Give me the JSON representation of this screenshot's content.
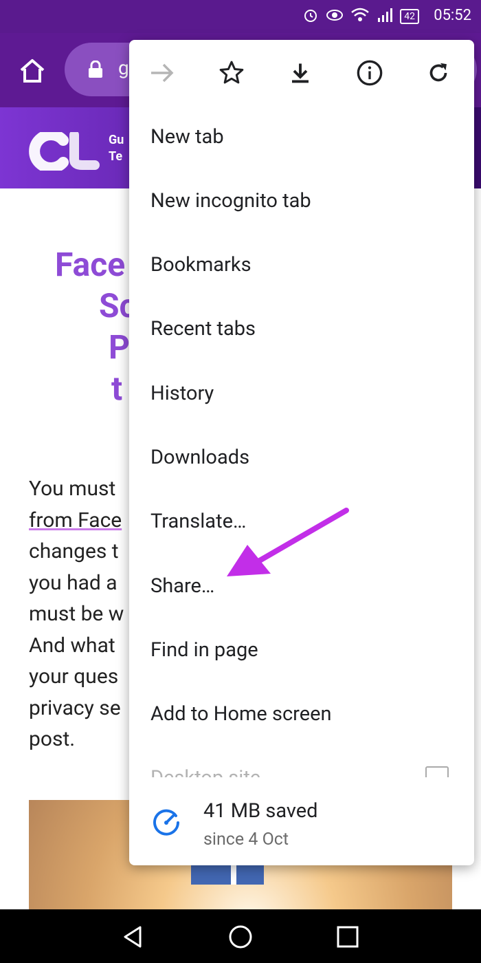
{
  "status": {
    "time": "05:52",
    "battery": "42"
  },
  "toolbar": {
    "url_fragment": "g"
  },
  "site": {
    "brand_line1": "Gu",
    "brand_line2": "Te"
  },
  "article": {
    "title_lines": [
      "Face",
      "Sc",
      "P",
      "t"
    ],
    "paragraph_lines": [
      "You must",
      "from Face",
      "changes t",
      "you had a",
      "must be w",
      "And what",
      "your ques",
      "privacy se",
      "post."
    ]
  },
  "menu": {
    "icons": [
      "forward-icon",
      "star-icon",
      "download-icon",
      "info-icon",
      "refresh-icon"
    ],
    "items": [
      "New tab",
      "New incognito tab",
      "Bookmarks",
      "Recent tabs",
      "History",
      "Downloads",
      "Translate…",
      "Share…",
      "Find in page",
      "Add to Home screen"
    ],
    "desktop_site": "Desktop site",
    "data_saved": "41 MB saved",
    "data_since": "since 4 Oct"
  },
  "colors": {
    "toolbar": "#5e1a93",
    "accent_arrow": "#c22ee8",
    "title": "#8e4bd6"
  }
}
